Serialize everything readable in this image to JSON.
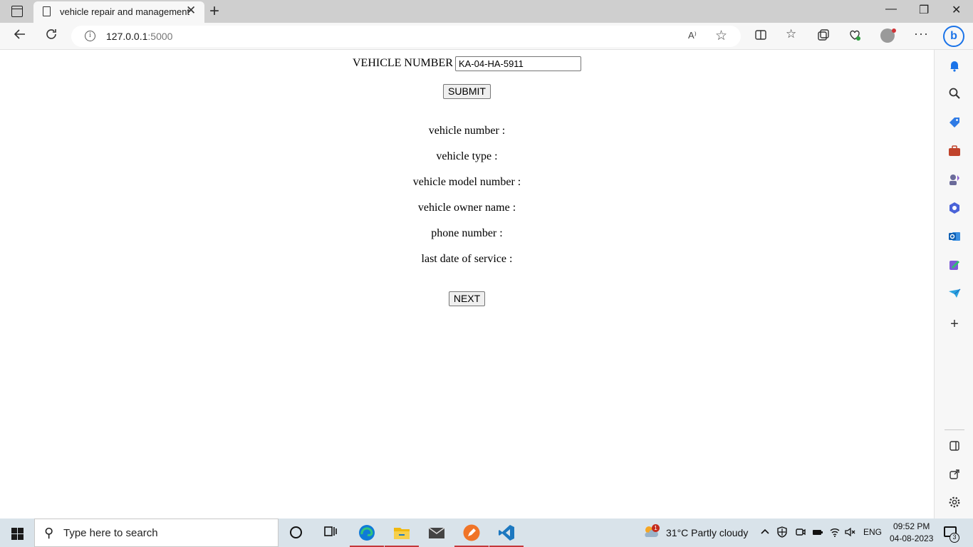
{
  "browser": {
    "tab_title": "vehicle repair and management",
    "tab_close": "✕",
    "new_tab": "+",
    "address_host": "127.0.0.1",
    "address_port": ":5000",
    "read_aloud": "A⁾",
    "more": "···",
    "window_controls": {
      "minimize": "—",
      "restore": "❐",
      "close": "✕"
    },
    "bing": "b"
  },
  "form": {
    "vehicle_number_label": "VEHICLE NUMBER",
    "vehicle_number_value": "KA-04-HA-5911",
    "submit_label": "SUBMIT",
    "next_label": "NEXT"
  },
  "details": [
    {
      "label": "vehicle number :"
    },
    {
      "label": "vehicle type :"
    },
    {
      "label": "vehicle model number :"
    },
    {
      "label": "vehicle owner name :"
    },
    {
      "label": "phone number :"
    },
    {
      "label": "last date of service :"
    }
  ],
  "taskbar": {
    "search_placeholder": "Type here to search",
    "weather_badge": "1",
    "weather": "31°C  Partly cloudy",
    "language": "ENG",
    "time": "09:52 PM",
    "date": "04-08-2023",
    "notification_count": "3"
  },
  "colors": {
    "edge_blue": "#0f7bd7",
    "edge_green": "#34c47c",
    "files_yellow": "#f0b80e",
    "mail_gray": "#444444",
    "app_orange": "#f07427",
    "vscode_blue": "#1c78c0"
  }
}
